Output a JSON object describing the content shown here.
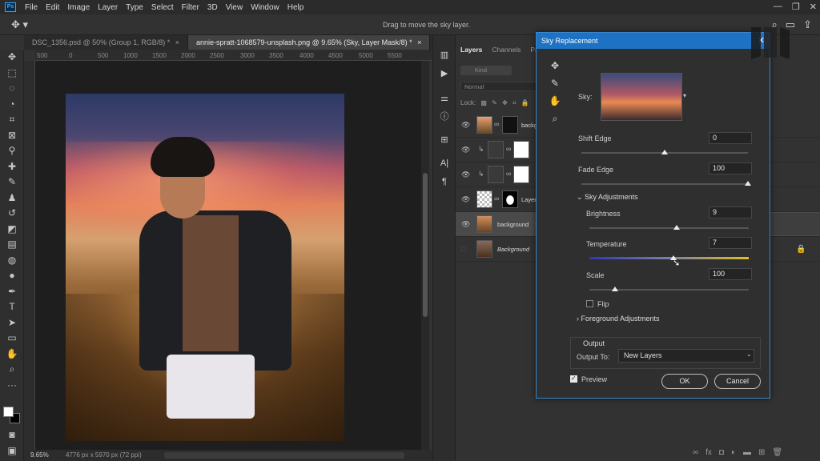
{
  "menubar": {
    "logo": "Ps",
    "items": [
      "File",
      "Edit",
      "Image",
      "Layer",
      "Type",
      "Select",
      "Filter",
      "3D",
      "View",
      "Window",
      "Help"
    ],
    "win_controls": [
      "—",
      "❐",
      "✕"
    ]
  },
  "options_bar": {
    "hint": "Drag to move the sky layer."
  },
  "doc_tabs": [
    {
      "label": "DSC_1356.psd @ 50% (Group 1, RGB/8) *",
      "close": "×"
    },
    {
      "label": "annie-spratt-1068579-unsplash.png @ 9.65% (Sky, Layer Mask/8) *",
      "close": "×"
    }
  ],
  "ruler_labels": [
    "500",
    "0",
    "500",
    "1000",
    "1500",
    "2000",
    "2500",
    "3000",
    "3500",
    "4000",
    "4500",
    "5000",
    "5500"
  ],
  "status_bar": {
    "zoom": "9.65%",
    "doc_info": "4776 px x 5970 px (72 ppi)"
  },
  "panel": {
    "tabs": [
      "Layers",
      "Channels",
      "Path"
    ],
    "kind_filter": "Kind",
    "blend_mode": "Normal",
    "lock_label": "Lock:",
    "layers": [
      {
        "name": "backg"
      },
      {
        "name": ""
      },
      {
        "name": ""
      },
      {
        "name": "Layer"
      },
      {
        "name": "background"
      },
      {
        "name": "Background"
      }
    ]
  },
  "dialog": {
    "title": "Sky Replacement",
    "sky_label": "Sky:",
    "shift_edge": {
      "label": "Shift Edge",
      "value": "0",
      "fraction": 0.5
    },
    "fade_edge": {
      "label": "Fade Edge",
      "value": "100",
      "fraction": 1.0
    },
    "sky_adjustments": {
      "label": "Sky Adjustments"
    },
    "brightness": {
      "label": "Brightness",
      "value": "9",
      "fraction": 0.55
    },
    "temperature": {
      "label": "Temperature",
      "value": "7",
      "fraction": 0.53
    },
    "scale": {
      "label": "Scale",
      "value": "100",
      "fraction": 0.16
    },
    "flip": {
      "label": "Flip",
      "checked": false
    },
    "foreground_adjustments": {
      "label": "Foreground Adjustments"
    },
    "output": {
      "title": "Output",
      "to_label": "Output To:",
      "to_value": "New Layers"
    },
    "preview": {
      "label": "Preview",
      "checked": true
    },
    "ok_label": "OK",
    "cancel_label": "Cancel"
  }
}
